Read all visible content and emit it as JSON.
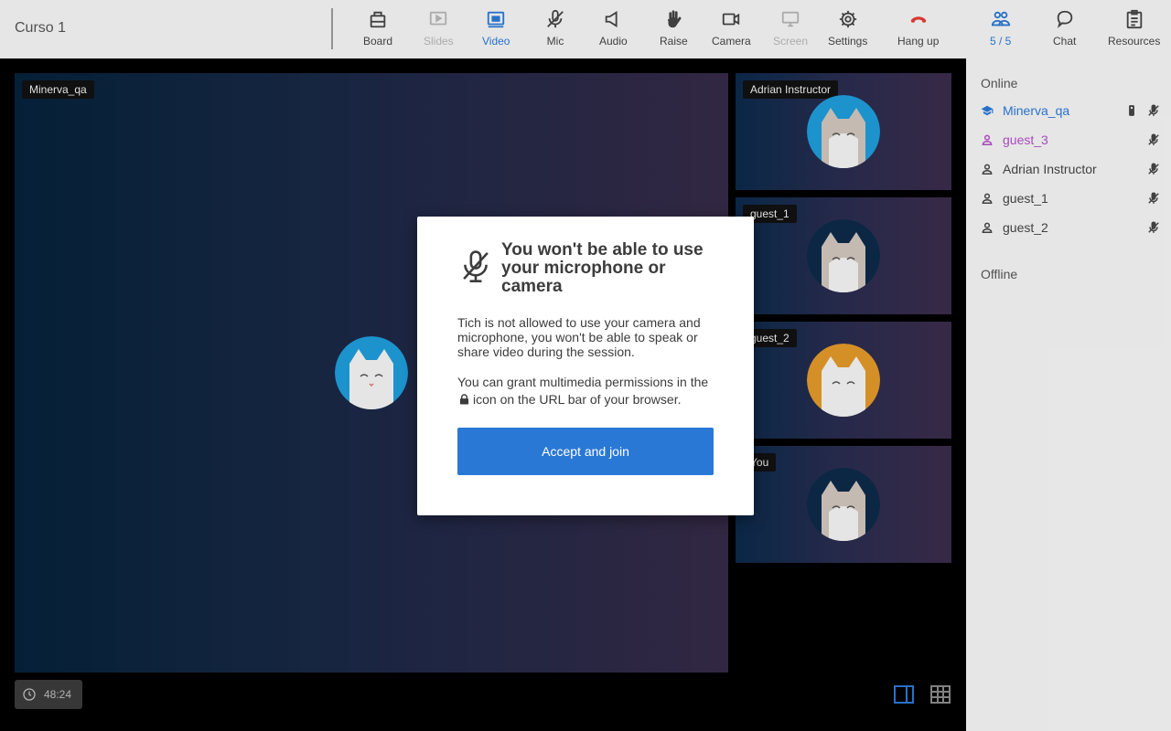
{
  "header": {
    "course_title": "Curso 1",
    "tools": {
      "board": "Board",
      "slides": "Slides",
      "video": "Video",
      "mic": "Mic",
      "audio": "Audio",
      "raise": "Raise",
      "camera": "Camera",
      "screen": "Screen",
      "settings": "Settings",
      "hangup": "Hang up"
    },
    "participants_count": "5 / 5",
    "chat": "Chat",
    "resources": "Resources"
  },
  "sidebar": {
    "online_heading": "Online",
    "offline_heading": "Offline",
    "participants": [
      {
        "name": "Minerva_qa",
        "role": "teacher",
        "color": "#2a78d5"
      },
      {
        "name": "guest_3",
        "role": "student",
        "color": "#b04fc6"
      },
      {
        "name": "Adrian Instructor",
        "role": "student",
        "color": "#444444"
      },
      {
        "name": "guest_1",
        "role": "student",
        "color": "#444444"
      },
      {
        "name": "guest_2",
        "role": "student",
        "color": "#444444"
      }
    ]
  },
  "stage": {
    "main_name": "Minerva_qa",
    "tiles": [
      {
        "name": "Adrian Instructor"
      },
      {
        "name": "guest_1"
      },
      {
        "name": "guest_2"
      },
      {
        "name": "You"
      }
    ],
    "timer": "48:24"
  },
  "modal": {
    "title": "You won't be able to use your microphone or camera",
    "text1": "Tich is not allowed to use your camera and microphone, you won't be able to speak or share video during the session.",
    "text2_before": "You can grant multimedia permissions in the",
    "text2_after": "icon on the URL bar of your browser.",
    "button": "Accept and join"
  },
  "colors": {
    "accent": "#2a78d5",
    "hangup": "#e53935",
    "avatar_blue": "#1e9bd7",
    "avatar_dark": "#0d2a48",
    "avatar_orange": "#e0982a"
  },
  "icons": [
    "board-icon",
    "slides-icon",
    "video-icon",
    "mic-off-icon",
    "audio-icon",
    "raise-hand-icon",
    "camera-icon",
    "screen-icon",
    "settings-icon",
    "hangup-icon",
    "participants-icon",
    "chat-icon",
    "resources-icon",
    "teacher-icon",
    "user-icon",
    "mic-muted-icon",
    "clock-icon",
    "lock-icon",
    "layout-sidebar-icon",
    "layout-grid-icon"
  ]
}
